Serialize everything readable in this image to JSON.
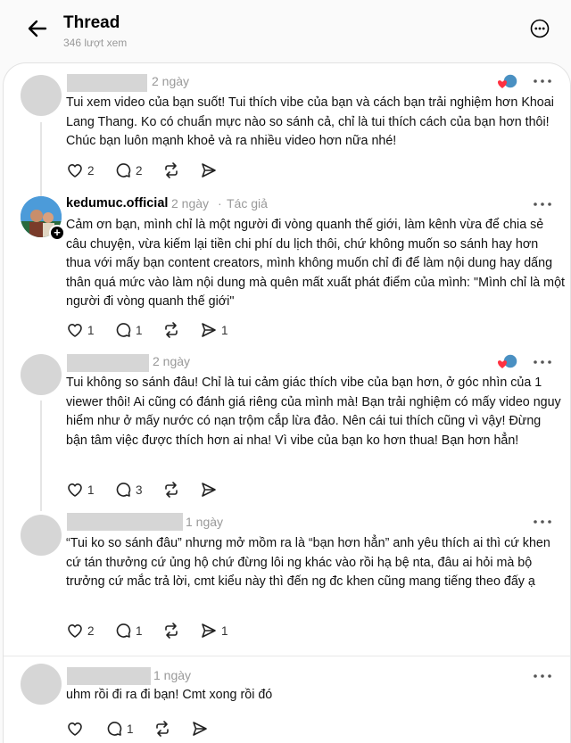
{
  "header": {
    "title": "Thread",
    "views": "346 lượt xem"
  },
  "posts": [
    {
      "username": "",
      "time": "2 ngày",
      "text": "Tui xem video của bạn suốt! Tui thích vibe của bạn và cách bạn trải nghiệm hơn Khoai Lang Thang. Ko có chuẩn mực nào so sánh cả, chỉ là tui thích cách của bạn hơn thôi! Chúc bạn luôn mạnh khoẻ và ra nhiều video hơn nữa nhé!",
      "likes": "2",
      "replies": "2",
      "reposts": "",
      "shares": "",
      "liked_by_author": true
    },
    {
      "username": "kedumuc.official",
      "time": "2 ngày",
      "author_tag": "Tác giả",
      "text": "Cảm ơn bạn, mình chỉ là một người đi vòng quanh thế giới, làm kênh vừa để chia sẻ câu chuyện, vừa kiếm lại tiền chi phí du lịch thôi, chứ không muốn so sánh hay hơn thua với mấy bạn content creators, mình không muốn chỉ đi để làm nội dung hay dấng thân quá mức vào làm nội dung mà quên mất xuất phát điểm của mình: \"Mình chỉ là một người đi vòng quanh thế giới\"",
      "likes": "1",
      "replies": "1",
      "reposts": "",
      "shares": "1",
      "liked_by_author": false
    },
    {
      "username": "",
      "time": "2 ngày",
      "text": "Tui không so sánh đâu! Chỉ là tui cảm giác thích vibe của bạn hơn, ở góc nhìn của 1 viewer thôi! Ai cũng có đánh giá riêng của mình mà! Bạn trải nghiệm có mấy video nguy hiểm như ở mấy nước có nạn trộm cắp lừa đảo. Nên cái tui thích cũng vì vậy! Đừng bận tâm việc được thích hơn ai nha! Vì vibe của bạn ko hơn thua! Bạn hơn hẳn!",
      "likes": "1",
      "replies": "3",
      "reposts": "",
      "shares": "",
      "liked_by_author": true
    },
    {
      "username": "",
      "time": "1 ngày",
      "text": "“Tui ko so sánh đâu” nhưng mở mồm ra là “bạn hơn hẳn” anh yêu thích ai thì cứ khen cứ tán thưởng cứ ủng hộ chứ đừng lôi ng khác vào rồi hạ bệ nta, đâu ai hỏi mà bộ trưởng cứ mắc trả lời, cmt kiểu này thì đến ng đc khen cũng mang tiếng theo đấy ạ",
      "likes": "2",
      "replies": "1",
      "reposts": "",
      "shares": "1",
      "liked_by_author": false
    },
    {
      "username": "",
      "time": "1 ngày",
      "text": "uhm rồi đi ra đi bạn! Cmt xong rồi đó",
      "likes": "",
      "replies": "1",
      "reposts": "",
      "shares": "",
      "liked_by_author": false
    }
  ]
}
